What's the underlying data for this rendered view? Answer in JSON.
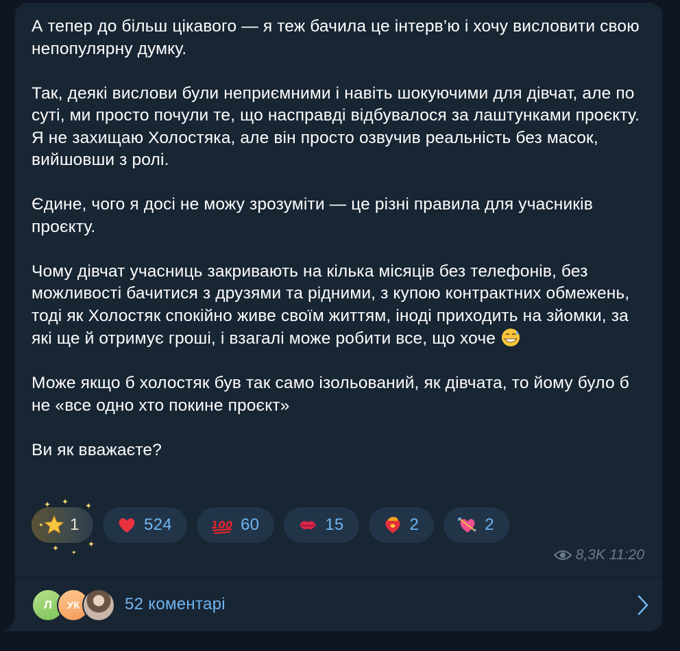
{
  "post": {
    "paragraphs": [
      "А тепер до більш цікавого — я теж бачила це інтерв’ю і хочу висловити свою непопулярну думку.",
      "Так, деякі вислови були неприємними і навіть шокуючими для дівчат, але по суті, ми просто почули те, що насправді відбувалося за лаштунками проєкту. Я не захищаю Холостяка, але він просто озвучив реальність без масок, вийшовши з ролі.",
      "Єдине, чого я досі не можу зрозуміти — це різні правила для учасників проєкту.",
      "Чому дівчат учасниць закривають на кілька місяців без телефонів, без можливості бачитися з друзями та рідними, з купою контрактних обмежень,\nтоді як Холостяк спокійно живе своїм життям, іноді приходить на зйомки, за які ще й отримує гроші, і взагалі може робити все, що хоче ",
      "Може якщо б холостяк був так само ізольований, як дівчата, то йому було б не «все одно хто покине проєкт»",
      "Ви як вважаєте?"
    ],
    "inline_emoji": "sweat-smile-emoji"
  },
  "reactions": [
    {
      "icon": "star-emoji",
      "count": "1"
    },
    {
      "icon": "red-heart-emoji",
      "count": "524"
    },
    {
      "icon": "hundred-points-emoji",
      "count": "60"
    },
    {
      "icon": "kiss-mark-emoji",
      "count": "15"
    },
    {
      "icon": "heart-on-fire-emoji",
      "count": "2"
    },
    {
      "icon": "heart-with-arrow-emoji",
      "count": "2"
    }
  ],
  "meta": {
    "views": "8,3K",
    "time": "11:20"
  },
  "comments": {
    "avatars": [
      {
        "initials": "Л",
        "color": "#8fd06a"
      },
      {
        "initials": "УК",
        "color": "#f5a86a"
      },
      {
        "initials": "",
        "color": "#c9b6a8"
      }
    ],
    "label": "52 коментарі"
  },
  "colors": {
    "background": "#0e1621",
    "bubble": "#182533",
    "chip": "#213448",
    "accent": "#6fb5f0",
    "meta": "#6c7b8b"
  }
}
